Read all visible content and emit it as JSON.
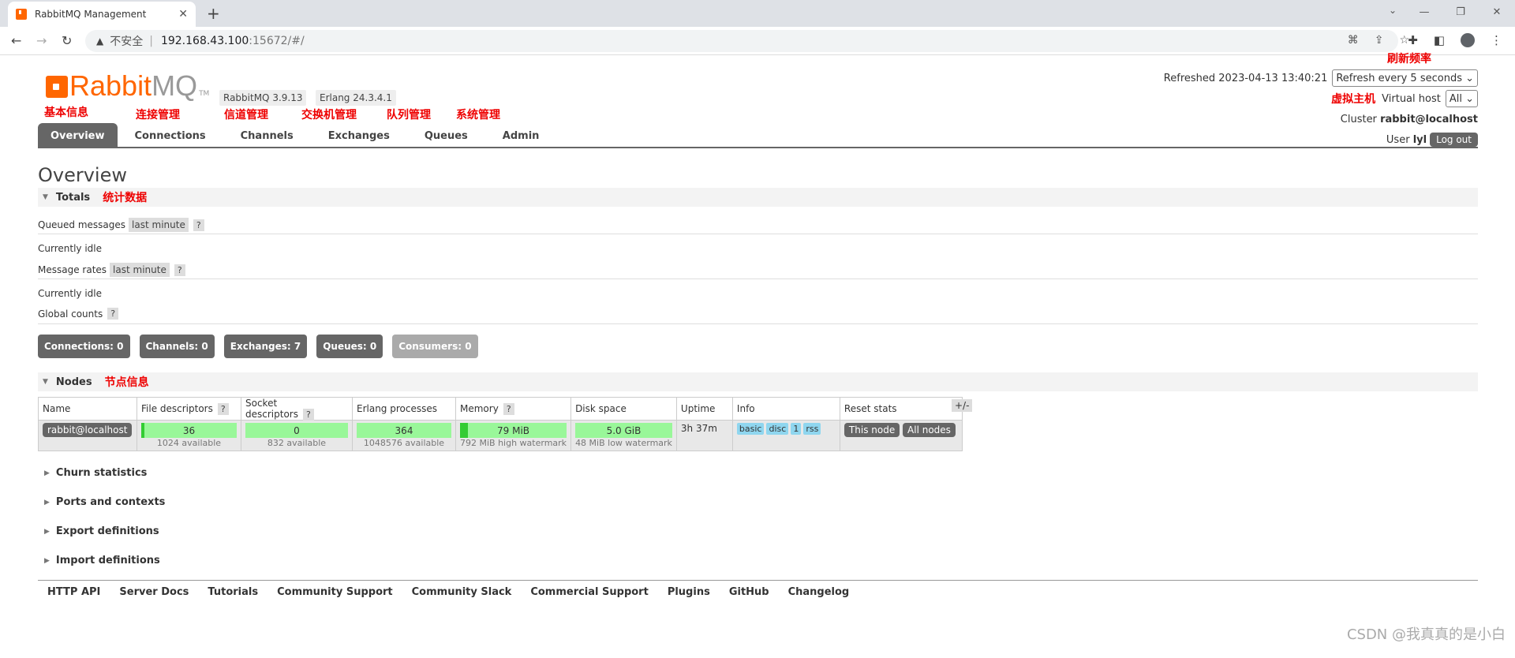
{
  "browser": {
    "tab_title": "RabbitMQ Management",
    "insecure_label": "不安全",
    "url_host": "192.168.43.100",
    "url_path": ":15672/#/"
  },
  "header": {
    "brand_a": "Rabbit",
    "brand_b": "MQ",
    "tm": "TM",
    "rabbit_version": "RabbitMQ 3.9.13",
    "erlang_version": "Erlang 24.3.4.1",
    "refreshed": "Refreshed 2023-04-13 13:40:21",
    "refresh_option": "Refresh every 5 seconds",
    "vhost_label": "Virtual host",
    "vhost_value": "All",
    "cluster_label": "Cluster",
    "cluster_value": "rabbit@localhost",
    "user_label": "User",
    "user_value": "lyl",
    "logout": "Log out"
  },
  "annotations": {
    "basic": "基本信息",
    "connections": "连接管理",
    "channels": "信道管理",
    "exchanges": "交换机管理",
    "queues": "队列管理",
    "admin": "系统管理",
    "refresh": "刷新频率",
    "vhost": "虚拟主机",
    "totals": "统计数据",
    "nodes": "节点信息"
  },
  "nav": [
    "Overview",
    "Connections",
    "Channels",
    "Exchanges",
    "Queues",
    "Admin"
  ],
  "overview": {
    "title": "Overview",
    "totals": "Totals",
    "queued_messages": "Queued messages",
    "last_minute": "last minute",
    "q": "?",
    "idle": "Currently idle",
    "message_rates": "Message rates",
    "global_counts": "Global counts",
    "counts": [
      "Connections: 0",
      "Channels: 0",
      "Exchanges: 7",
      "Queues: 0",
      "Consumers: 0"
    ]
  },
  "nodes": {
    "title": "Nodes",
    "headers": [
      "Name",
      "File descriptors",
      "Socket descriptors",
      "Erlang processes",
      "Memory",
      "Disk space",
      "Uptime",
      "Info",
      "Reset stats"
    ],
    "name": "rabbit@localhost",
    "fd": "36",
    "fd_sub": "1024 available",
    "sd": "0",
    "sd_sub": "832 available",
    "ep": "364",
    "ep_sub": "1048576 available",
    "mem": "79 MiB",
    "mem_sub": "792 MiB high watermark",
    "disk": "5.0 GiB",
    "disk_sub": "48 MiB low watermark",
    "uptime": "3h 37m",
    "info": [
      "basic",
      "disc",
      "1",
      "rss"
    ],
    "reset_this": "This node",
    "reset_all": "All nodes",
    "plusminus": "+/-"
  },
  "collapsed": [
    "Churn statistics",
    "Ports and contexts",
    "Export definitions",
    "Import definitions"
  ],
  "footer": [
    "HTTP API",
    "Server Docs",
    "Tutorials",
    "Community Support",
    "Community Slack",
    "Commercial Support",
    "Plugins",
    "GitHub",
    "Changelog"
  ],
  "watermark": "CSDN @我真真的是小白"
}
